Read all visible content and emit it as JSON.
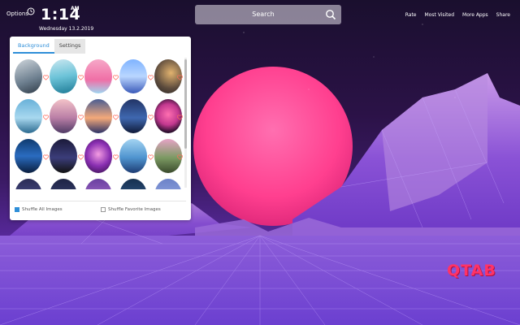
{
  "header": {
    "options_label": "Options",
    "time": "1:14",
    "ampm": "AM",
    "date": "Wednesday 13.2.2019",
    "search_label": "Search",
    "nav": [
      "Rate",
      "Most Visited",
      "More Apps",
      "Share"
    ]
  },
  "panel": {
    "tabs": [
      "Background",
      "Settings"
    ],
    "active_tab": "Background",
    "shuffle_all_label": "Shuffle All Images",
    "shuffle_all_checked": true,
    "shuffle_fav_label": "Shuffle Favorite Images",
    "shuffle_fav_checked": false
  },
  "logo_text": "QTAB",
  "colors": {
    "accent": "#2e8ed8",
    "heart": "#ff6a5a",
    "logo": "#ff3366",
    "sun": "#ff4f9a"
  }
}
